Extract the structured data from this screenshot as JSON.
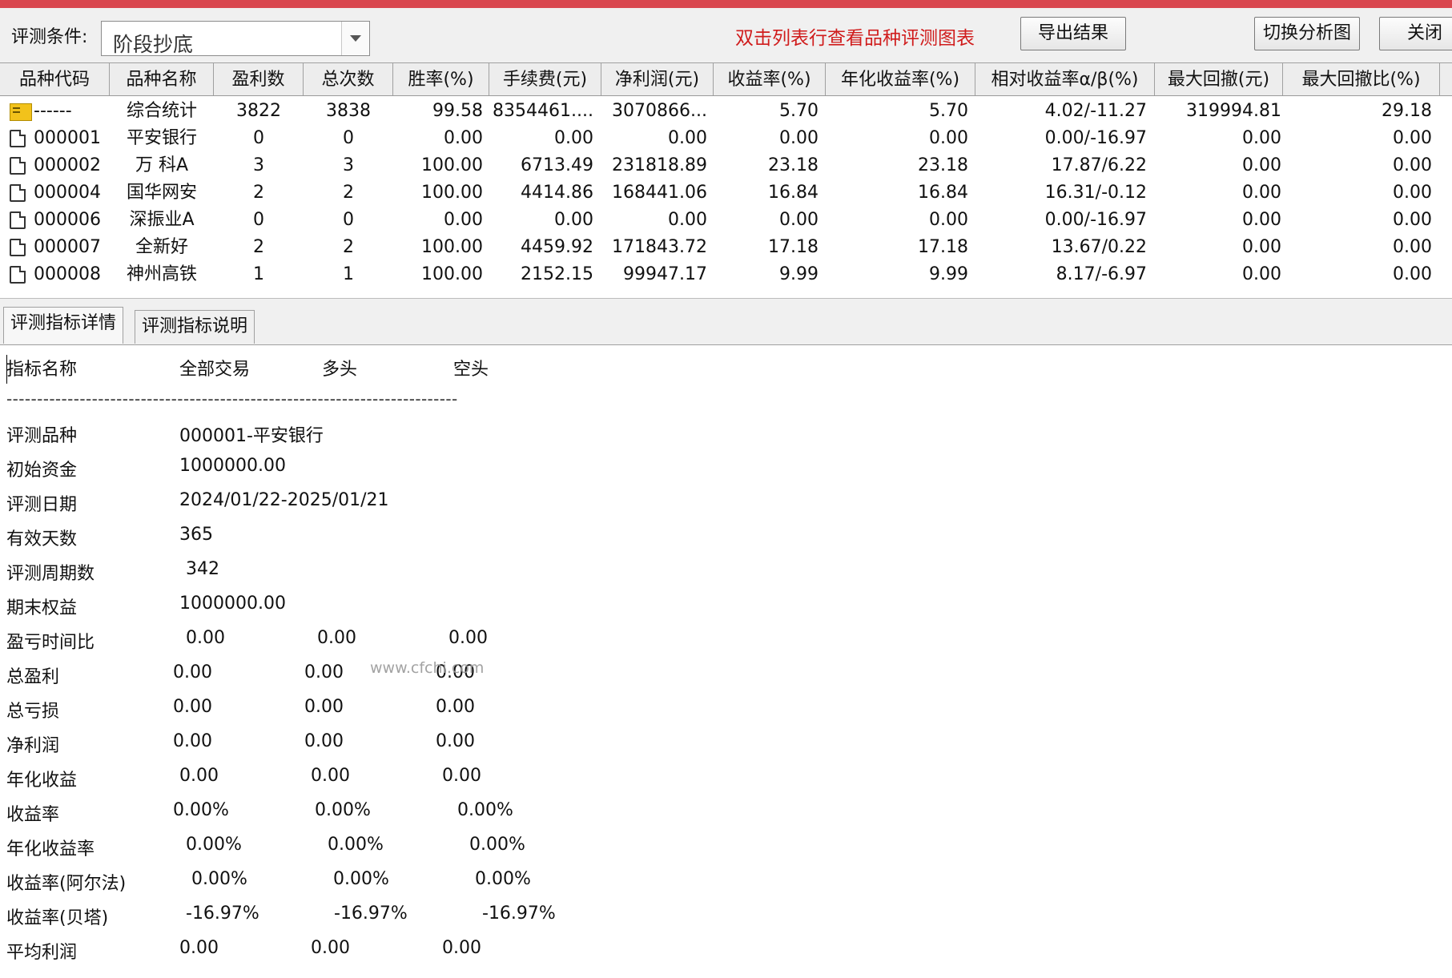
{
  "toolbar": {
    "condition_label": "评测条件:",
    "condition_value": "阶段抄底",
    "hint": "双击列表行查看品种评测图表",
    "export_label": "导出结果",
    "switch_label": "切换分析图",
    "close_label": "关闭"
  },
  "table": {
    "headers": [
      "品种代码",
      "品种名称",
      "盈利数",
      "总次数",
      "胜率(%)",
      "手续费(元)",
      "净利润(元)",
      "收益率(%)",
      "年化收益率(%)",
      "相对收益率α/β(%)",
      "最大回撤(元)",
      "最大回撤比(%)"
    ],
    "rows": [
      {
        "code": "------",
        "name": "综合统计",
        "profit_count": "3822",
        "total": "3838",
        "win_rate": "99.58",
        "fee": "8354461....",
        "net": "3070866...",
        "ret": "5.70",
        "annual": "5.70",
        "rel": "4.02/-11.27",
        "mdd": "319994.81",
        "mdd_ratio": "29.18"
      },
      {
        "code": "000001",
        "name": "平安银行",
        "profit_count": "0",
        "total": "0",
        "win_rate": "0.00",
        "fee": "0.00",
        "net": "0.00",
        "ret": "0.00",
        "annual": "0.00",
        "rel": "0.00/-16.97",
        "mdd": "0.00",
        "mdd_ratio": "0.00"
      },
      {
        "code": "000002",
        "name": "万 科A",
        "profit_count": "3",
        "total": "3",
        "win_rate": "100.00",
        "fee": "6713.49",
        "net": "231818.89",
        "ret": "23.18",
        "annual": "23.18",
        "rel": "17.87/6.22",
        "mdd": "0.00",
        "mdd_ratio": "0.00"
      },
      {
        "code": "000004",
        "name": "国华网安",
        "profit_count": "2",
        "total": "2",
        "win_rate": "100.00",
        "fee": "4414.86",
        "net": "168441.06",
        "ret": "16.84",
        "annual": "16.84",
        "rel": "16.31/-0.12",
        "mdd": "0.00",
        "mdd_ratio": "0.00"
      },
      {
        "code": "000006",
        "name": "深振业A",
        "profit_count": "0",
        "total": "0",
        "win_rate": "0.00",
        "fee": "0.00",
        "net": "0.00",
        "ret": "0.00",
        "annual": "0.00",
        "rel": "0.00/-16.97",
        "mdd": "0.00",
        "mdd_ratio": "0.00"
      },
      {
        "code": "000007",
        "name": "全新好",
        "profit_count": "2",
        "total": "2",
        "win_rate": "100.00",
        "fee": "4459.92",
        "net": "171843.72",
        "ret": "17.18",
        "annual": "17.18",
        "rel": "13.67/0.22",
        "mdd": "0.00",
        "mdd_ratio": "0.00"
      },
      {
        "code": "000008",
        "name": "神州高铁",
        "profit_count": "1",
        "total": "1",
        "win_rate": "100.00",
        "fee": "2152.15",
        "net": "99947.17",
        "ret": "9.99",
        "annual": "9.99",
        "rel": "8.17/-6.97",
        "mdd": "0.00",
        "mdd_ratio": "0.00"
      }
    ]
  },
  "tabs": {
    "details": "评测指标详情",
    "description": "评测指标说明"
  },
  "details": {
    "headers": {
      "name": "指标名称",
      "all": "全部交易",
      "long": "多头",
      "short": "空头"
    },
    "separator": "--------------------------------------------------------------------------",
    "info": [
      {
        "label": "评测品种",
        "value": "000001-平安银行"
      },
      {
        "label": "初始资金",
        "value": "1000000.00"
      },
      {
        "label": "评测日期",
        "value": "2024/01/22-2025/01/21"
      },
      {
        "label": "有效天数",
        "value": "365"
      },
      {
        "label": "评测周期数",
        "value": "342"
      },
      {
        "label": "期末权益",
        "value": "1000000.00"
      }
    ],
    "metrics": [
      {
        "label": "盈亏时间比",
        "all": "0.00",
        "long": "0.00",
        "short": "0.00"
      },
      {
        "label": "总盈利",
        "all": "0.00",
        "long": "0.00",
        "short": "0.00"
      },
      {
        "label": "总亏损",
        "all": "0.00",
        "long": "0.00",
        "short": "0.00"
      },
      {
        "label": "净利润",
        "all": "0.00",
        "long": "0.00",
        "short": "0.00"
      },
      {
        "label": "年化收益",
        "all": "0.00",
        "long": "0.00",
        "short": "0.00"
      },
      {
        "label": "收益率",
        "all": "0.00%",
        "long": "0.00%",
        "short": "0.00%"
      },
      {
        "label": "年化收益率",
        "all": "0.00%",
        "long": "0.00%",
        "short": "0.00%"
      },
      {
        "label": "收益率(阿尔法)",
        "all": "0.00%",
        "long": "0.00%",
        "short": "0.00%"
      },
      {
        "label": "收益率(贝塔)",
        "all": "-16.97%",
        "long": "-16.97%",
        "short": "-16.97%"
      },
      {
        "label": "平均利润",
        "all": "0.00",
        "long": "0.00",
        "short": "0.00"
      }
    ],
    "watermark": "www.cfchi.com"
  },
  "colors": {
    "top_strip": "#d9474f",
    "hint": "#d01c1c",
    "folder_icon": "#f2c21b"
  }
}
